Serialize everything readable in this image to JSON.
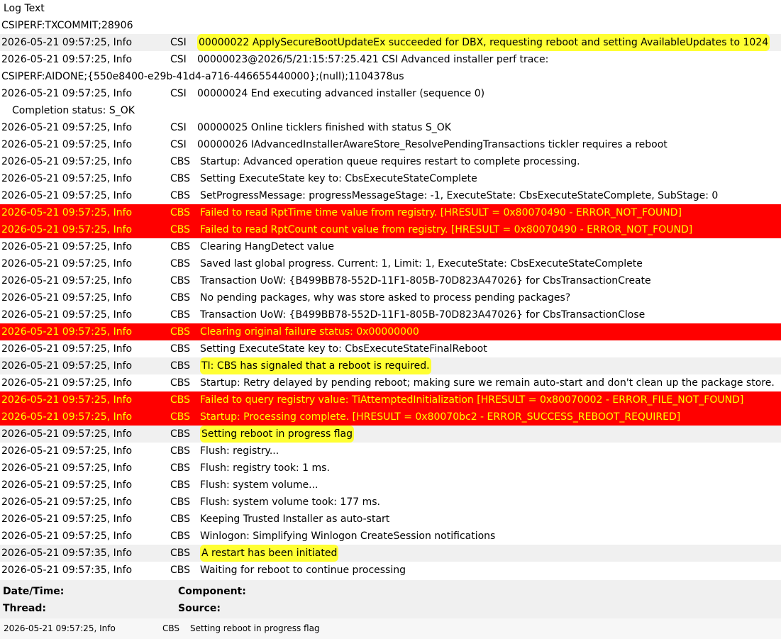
{
  "header": {
    "title": "Log Text"
  },
  "rows": [
    {
      "cont": "CSIPERF:TXCOMMIT;28906"
    },
    {
      "dt": "2026-05-21 09:57:25, Info",
      "comp": "CSI",
      "msg": "00000022 ApplySecureBootUpdateEx succeeded for DBX, requesting reboot and setting AvailableUpdates to 1024",
      "style": "alt",
      "highlight": true
    },
    {
      "dt": "2026-05-21 09:57:25, Info",
      "comp": "CSI",
      "msg": "00000023@2026/5/21:15:57:25.421 CSI Advanced installer perf trace:"
    },
    {
      "cont": "CSIPERF:AIDONE;{550e8400-e29b-41d4-a716-446655440000};(null);1104378us"
    },
    {
      "dt": "2026-05-21 09:57:25, Info",
      "comp": "CSI",
      "msg": "00000024 End executing advanced installer (sequence 0)"
    },
    {
      "cont": "Completion status: S_OK",
      "indent": true
    },
    {
      "dt": "2026-05-21 09:57:25, Info",
      "comp": "CSI",
      "msg": "00000025 Online ticklers finished with status S_OK"
    },
    {
      "dt": "2026-05-21 09:57:25, Info",
      "comp": "CSI",
      "msg": "00000026 IAdvancedInstallerAwareStore_ResolvePendingTransactions tickler requires a reboot"
    },
    {
      "dt": "2026-05-21 09:57:25, Info",
      "comp": "CBS",
      "msg": "Startup: Advanced operation queue requires restart to complete processing."
    },
    {
      "dt": "2026-05-21 09:57:25, Info",
      "comp": "CBS",
      "msg": "Setting ExecuteState key to: CbsExecuteStateComplete"
    },
    {
      "dt": "2026-05-21 09:57:25, Info",
      "comp": "CBS",
      "msg": "SetProgressMessage: progressMessageStage: -1, ExecuteState: CbsExecuteStateComplete, SubStage: 0"
    },
    {
      "dt": "2026-05-21 09:57:25, Info",
      "comp": "CBS",
      "msg": "Failed to read RptTime time value from registry. [HRESULT = 0x80070490 - ERROR_NOT_FOUND]",
      "style": "err"
    },
    {
      "dt": "2026-05-21 09:57:25, Info",
      "comp": "CBS",
      "msg": "Failed to read RptCount count value from registry. [HRESULT = 0x80070490 - ERROR_NOT_FOUND]",
      "style": "err"
    },
    {
      "dt": "2026-05-21 09:57:25, Info",
      "comp": "CBS",
      "msg": "Clearing HangDetect value"
    },
    {
      "dt": "2026-05-21 09:57:25, Info",
      "comp": "CBS",
      "msg": "Saved last global progress. Current: 1, Limit: 1, ExecuteState: CbsExecuteStateComplete"
    },
    {
      "dt": "2026-05-21 09:57:25, Info",
      "comp": "CBS",
      "msg": "Transaction UoW: {B499BB78-552D-11F1-805B-70D823A47026} for CbsTransactionCreate"
    },
    {
      "dt": "2026-05-21 09:57:25, Info",
      "comp": "CBS",
      "msg": "No pending packages, why was store asked to process pending packages?"
    },
    {
      "dt": "2026-05-21 09:57:25, Info",
      "comp": "CBS",
      "msg": "Transaction UoW: {B499BB78-552D-11F1-805B-70D823A47026} for CbsTransactionClose"
    },
    {
      "dt": "2026-05-21 09:57:25, Info",
      "comp": "CBS",
      "msg": "Clearing original failure status: 0x00000000",
      "style": "err"
    },
    {
      "dt": "2026-05-21 09:57:25, Info",
      "comp": "CBS",
      "msg": "Setting ExecuteState key to: CbsExecuteStateFinalReboot"
    },
    {
      "dt": "2026-05-21 09:57:25, Info",
      "comp": "CBS",
      "msg": "TI: CBS has signaled that a reboot is required.",
      "style": "alt",
      "highlight": true
    },
    {
      "dt": "2026-05-21 09:57:25, Info",
      "comp": "CBS",
      "msg": "Startup: Retry delayed by pending reboot; making sure we remain auto-start and don't clean up the package store."
    },
    {
      "dt": "2026-05-21 09:57:25, Info",
      "comp": "CBS",
      "msg": "Failed to query registry value: TiAttemptedInitialization [HRESULT = 0x80070002 - ERROR_FILE_NOT_FOUND]",
      "style": "err"
    },
    {
      "dt": "2026-05-21 09:57:25, Info",
      "comp": "CBS",
      "msg": "Startup: Processing complete. [HRESULT = 0x80070bc2 - ERROR_SUCCESS_REBOOT_REQUIRED]",
      "style": "err"
    },
    {
      "dt": "2026-05-21 09:57:25, Info",
      "comp": "CBS",
      "msg": "Setting reboot in progress flag",
      "style": "alt",
      "highlight": true
    },
    {
      "dt": "2026-05-21 09:57:25, Info",
      "comp": "CBS",
      "msg": "Flush: registry..."
    },
    {
      "dt": "2026-05-21 09:57:25, Info",
      "comp": "CBS",
      "msg": "Flush: registry took: 1 ms."
    },
    {
      "dt": "2026-05-21 09:57:25, Info",
      "comp": "CBS",
      "msg": "Flush: system volume..."
    },
    {
      "dt": "2026-05-21 09:57:25, Info",
      "comp": "CBS",
      "msg": "Flush: system volume took: 177 ms."
    },
    {
      "dt": "2026-05-21 09:57:25, Info",
      "comp": "CBS",
      "msg": "Keeping Trusted Installer as auto-start"
    },
    {
      "dt": "2026-05-21 09:57:25, Info",
      "comp": "CBS",
      "msg": "Winlogon: Simplifying Winlogon CreateSession notifications"
    },
    {
      "dt": "2026-05-21 09:57:35, Info",
      "comp": "CBS",
      "msg": "A restart has been initiated",
      "style": "alt",
      "highlight": true
    },
    {
      "dt": "2026-05-21 09:57:35, Info",
      "comp": "CBS",
      "msg": "Waiting for reboot to continue processing"
    }
  ],
  "details": {
    "datetime_label": "Date/Time:",
    "component_label": "Component:",
    "thread_label": "Thread:",
    "source_label": "Source:",
    "selected_datetime": "2026-05-21 09:57:25, Info",
    "selected_component": "CBS",
    "selected_message": "Setting reboot in progress flag"
  },
  "colors": {
    "error_bg": "#ff0000",
    "error_text": "#ffff00",
    "highlight": "#ffff33",
    "alt_row": "#f0f0f0"
  }
}
